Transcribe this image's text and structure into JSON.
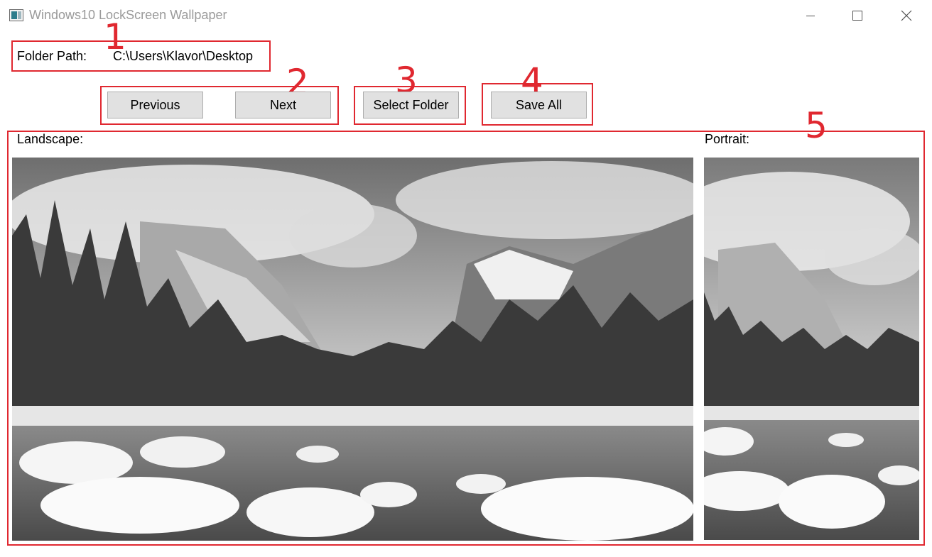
{
  "window": {
    "title": "Windows10 LockScreen Wallpaper",
    "icons": {
      "app": "app-icon",
      "minimize": "minimize-icon",
      "maximize": "maximize-icon",
      "close": "close-icon"
    }
  },
  "folder": {
    "label": "Folder Path:",
    "path": "C:\\Users\\Klavor\\Desktop"
  },
  "buttons": {
    "previous": "Previous",
    "next": "Next",
    "select_folder": "Select Folder",
    "save_all": "Save All"
  },
  "annotations": [
    "1",
    "2",
    "3",
    "4",
    "5"
  ],
  "images": {
    "landscape_label": "Landscape:",
    "portrait_label": "Portrait:"
  },
  "colors": {
    "annotation": "#e02830",
    "button_bg": "#e1e1e1",
    "title_text": "#9a9a9a"
  }
}
